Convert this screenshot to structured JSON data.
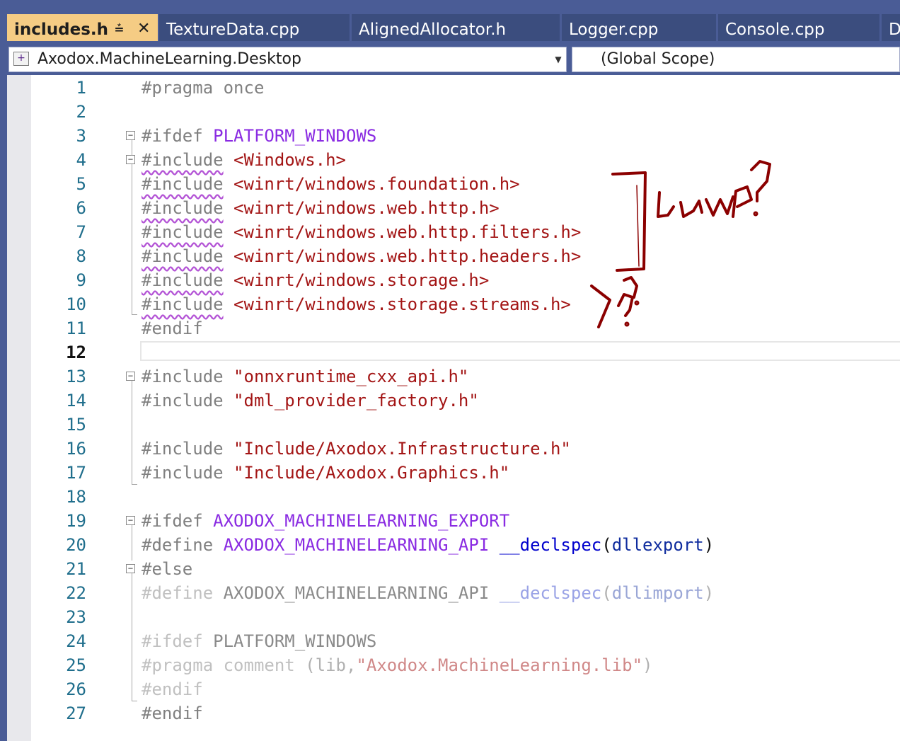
{
  "tabs": [
    {
      "label": "includes.h",
      "active": true,
      "pin_icon": "pin-icon",
      "close_icon": "close-icon"
    },
    {
      "label": "TextureData.cpp"
    },
    {
      "label": "AlignedAllocator.h"
    },
    {
      "label": "Logger.cpp"
    },
    {
      "label": "Console.cpp"
    },
    {
      "label": "D"
    }
  ],
  "navbar": {
    "project": "Axodox.MachineLearning.Desktop",
    "project_icon": "project-icon",
    "dropdown_icon": "chevron-down-icon",
    "scope": "(Global Scope)"
  },
  "editor": {
    "current_line": 12,
    "line_numbers": [
      "1",
      "2",
      "3",
      "4",
      "5",
      "6",
      "7",
      "8",
      "9",
      "10",
      "11",
      "12",
      "13",
      "14",
      "15",
      "16",
      "17",
      "18",
      "19",
      "20",
      "21",
      "22",
      "23",
      "24",
      "25",
      "26",
      "27"
    ],
    "lines": [
      [
        {
          "t": "#pragma once",
          "c": "pp"
        }
      ],
      [],
      [
        {
          "t": "#ifdef ",
          "c": "pp"
        },
        {
          "t": "PLATFORM_WINDOWS",
          "c": "macro"
        }
      ],
      [
        {
          "t": "#include",
          "c": "pp",
          "squiggle": true
        },
        {
          "t": " ",
          "c": "plain"
        },
        {
          "t": "<Windows.h>",
          "c": "str"
        }
      ],
      [
        {
          "t": "#include",
          "c": "pp",
          "squiggle": true
        },
        {
          "t": " ",
          "c": "plain"
        },
        {
          "t": "<winrt/windows.foundation.h>",
          "c": "str"
        }
      ],
      [
        {
          "t": "#include",
          "c": "pp",
          "squiggle": true
        },
        {
          "t": " ",
          "c": "plain"
        },
        {
          "t": "<winrt/windows.web.http.h>",
          "c": "str"
        }
      ],
      [
        {
          "t": "#include",
          "c": "pp",
          "squiggle": true
        },
        {
          "t": " ",
          "c": "plain"
        },
        {
          "t": "<winrt/windows.web.http.filters.h>",
          "c": "str"
        }
      ],
      [
        {
          "t": "#include",
          "c": "pp",
          "squiggle": true
        },
        {
          "t": " ",
          "c": "plain"
        },
        {
          "t": "<winrt/windows.web.http.headers.h>",
          "c": "str"
        }
      ],
      [
        {
          "t": "#include",
          "c": "pp",
          "squiggle": true
        },
        {
          "t": " ",
          "c": "plain"
        },
        {
          "t": "<winrt/windows.storage.h>",
          "c": "str"
        }
      ],
      [
        {
          "t": "#include",
          "c": "pp",
          "squiggle": true
        },
        {
          "t": " ",
          "c": "plain"
        },
        {
          "t": "<winrt/windows.storage.streams.h>",
          "c": "str"
        }
      ],
      [
        {
          "t": "#endif",
          "c": "pp"
        }
      ],
      [],
      [
        {
          "t": "#include ",
          "c": "pp"
        },
        {
          "t": "\"onnxruntime_cxx_api.h\"",
          "c": "str"
        }
      ],
      [
        {
          "t": "#include ",
          "c": "pp"
        },
        {
          "t": "\"dml_provider_factory.h\"",
          "c": "str"
        }
      ],
      [],
      [
        {
          "t": "#include ",
          "c": "pp"
        },
        {
          "t": "\"Include/Axodox.Infrastructure.h\"",
          "c": "str"
        }
      ],
      [
        {
          "t": "#include ",
          "c": "pp"
        },
        {
          "t": "\"Include/Axodox.Graphics.h\"",
          "c": "str"
        }
      ],
      [],
      [
        {
          "t": "#ifdef ",
          "c": "pp"
        },
        {
          "t": "AXODOX_MACHINELEARNING_EXPORT",
          "c": "macro"
        }
      ],
      [
        {
          "t": "#define ",
          "c": "pp"
        },
        {
          "t": "AXODOX_MACHINELEARNING_API",
          "c": "macro"
        },
        {
          "t": " ",
          "c": "plain"
        },
        {
          "t": "__declspec",
          "c": "kw"
        },
        {
          "t": "(",
          "c": "plain"
        },
        {
          "t": "dllexport",
          "c": "fn"
        },
        {
          "t": ")",
          "c": "plain"
        }
      ],
      [
        {
          "t": "#else",
          "c": "pp"
        }
      ],
      [
        {
          "t": "#define ",
          "c": "pp-dim"
        },
        {
          "t": "AXODOX_MACHINELEARNING_API",
          "c": "macro-dim"
        },
        {
          "t": " ",
          "c": "plain-dim"
        },
        {
          "t": "__declspec",
          "c": "kw-dim"
        },
        {
          "t": "(",
          "c": "plain-dim"
        },
        {
          "t": "dllimport",
          "c": "fn-dim"
        },
        {
          "t": ")",
          "c": "plain-dim"
        }
      ],
      [],
      [
        {
          "t": "#ifdef ",
          "c": "pp-dim"
        },
        {
          "t": "PLATFORM_WINDOWS",
          "c": "macro-dim"
        }
      ],
      [
        {
          "t": "#pragma comment ",
          "c": "pp-dim"
        },
        {
          "t": "(lib,",
          "c": "plain-dim"
        },
        {
          "t": "\"Axodox.MachineLearning.lib\"",
          "c": "str-dim"
        },
        {
          "t": ")",
          "c": "plain-dim"
        }
      ],
      [
        {
          "t": "#endif",
          "c": "pp-dim"
        }
      ],
      [
        {
          "t": "#endif",
          "c": "pp"
        }
      ]
    ]
  },
  "annotation": {
    "color": "#8b0000",
    "icon": "handwritten-annotation"
  }
}
